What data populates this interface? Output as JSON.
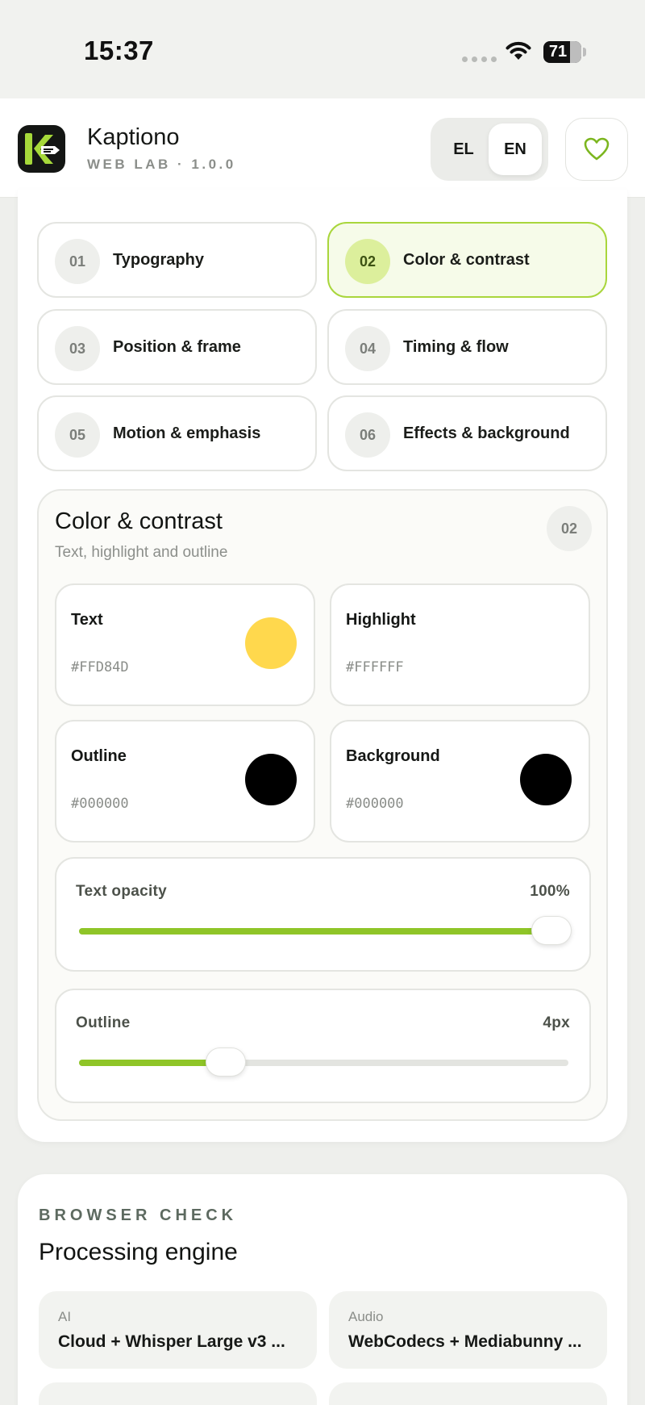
{
  "status_bar": {
    "time": "15:37",
    "battery": "71"
  },
  "header": {
    "app_name": "Kaptiono",
    "app_subtitle": "WEB LAB · 1.0.0",
    "lang_el": "EL",
    "lang_en": "EN",
    "active_lang": "EN",
    "fav_icon": "heart-icon",
    "brand_color": "#8fc528"
  },
  "steps": [
    {
      "num": "01",
      "label": "Typography",
      "active": false
    },
    {
      "num": "02",
      "label": "Color & contrast",
      "active": true
    },
    {
      "num": "03",
      "label": "Position & frame",
      "active": false
    },
    {
      "num": "04",
      "label": "Timing & flow",
      "active": false
    },
    {
      "num": "05",
      "label": "Motion & emphasis",
      "active": false
    },
    {
      "num": "06",
      "label": "Effects & background",
      "active": false
    }
  ],
  "panel": {
    "title": "Color & contrast",
    "subtitle": "Text, highlight and outline",
    "badge": "02",
    "swatches": [
      {
        "label": "Text",
        "hex": "#FFD84D",
        "color": "#FFD84D"
      },
      {
        "label": "Highlight",
        "hex": "#FFFFFF",
        "color": "#FFFFFF"
      },
      {
        "label": "Outline",
        "hex": "#000000",
        "color": "#000000"
      },
      {
        "label": "Background",
        "hex": "#000000",
        "color": "#000000"
      }
    ],
    "sliders": [
      {
        "label": "Text opacity",
        "value": "100%",
        "fraction": 1.0
      },
      {
        "label": "Outline",
        "value": "4px",
        "fraction": 0.3
      }
    ]
  },
  "browser_check": {
    "eyebrow": "BROWSER CHECK",
    "title": "Processing engine",
    "items": [
      {
        "key": "AI",
        "value": "Cloud + Whisper Large v3 ..."
      },
      {
        "key": "Audio",
        "value": "WebCodecs + Mediabunny ..."
      }
    ]
  }
}
